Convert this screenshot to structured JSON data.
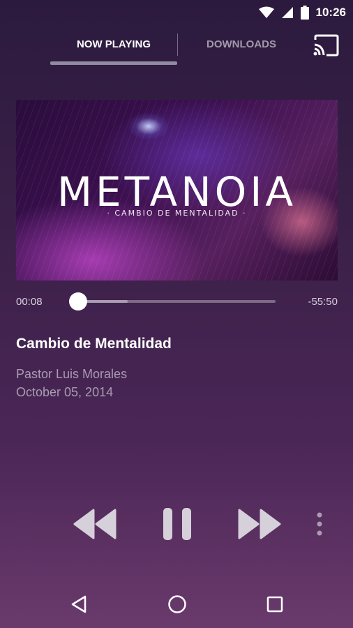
{
  "status_bar": {
    "time": "10:26",
    "icons": [
      "wifi-icon",
      "cell-signal-icon",
      "battery-icon"
    ]
  },
  "tabs": {
    "now_playing": "NOW PLAYING",
    "downloads": "DOWNLOADS",
    "active": "NOW PLAYING",
    "cast_icon": "cast-icon"
  },
  "artwork": {
    "title": "METANOIA",
    "subtitle": "· CAMBIO DE MENTALIDAD ·"
  },
  "player": {
    "elapsed": "00:08",
    "remaining": "-55:50",
    "progress": 0.0,
    "buffered": 0.25
  },
  "track": {
    "title": "Cambio de Mentalidad",
    "speaker": "Pastor Luis Morales",
    "date": "October 05, 2014"
  },
  "controls": [
    "rewind-icon",
    "pause-icon",
    "fast-forward-icon",
    "more-vert-icon"
  ],
  "nav": [
    "back-icon",
    "home-icon",
    "recent-apps-icon"
  ],
  "colors": {
    "background_top": "#2c1a3e",
    "background_bottom": "#6a3a6c",
    "inactive_text": "#a29aaa",
    "secondary_text": "#a99cb0"
  }
}
